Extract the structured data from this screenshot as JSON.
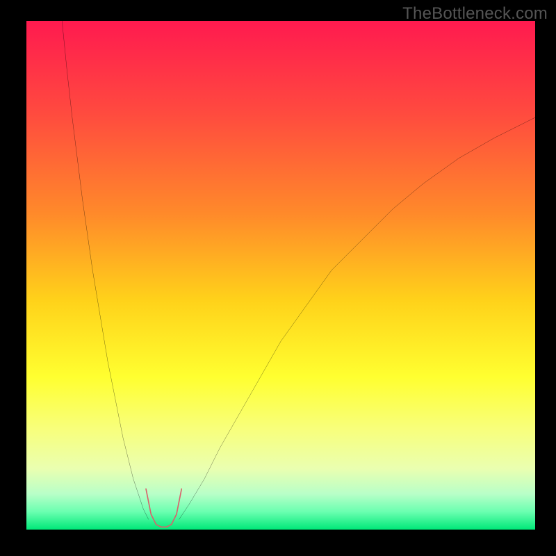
{
  "watermark": "TheBottleneck.com",
  "chart_data": {
    "type": "line",
    "title": "",
    "xlabel": "",
    "ylabel": "",
    "xlim": [
      0,
      100
    ],
    "ylim": [
      0,
      100
    ],
    "background_gradient": {
      "stops": [
        {
          "pos": 0.0,
          "color": "#ff1a4f"
        },
        {
          "pos": 0.18,
          "color": "#ff4a3f"
        },
        {
          "pos": 0.38,
          "color": "#ff8a2a"
        },
        {
          "pos": 0.55,
          "color": "#ffd21a"
        },
        {
          "pos": 0.7,
          "color": "#ffff30"
        },
        {
          "pos": 0.8,
          "color": "#f8ff7a"
        },
        {
          "pos": 0.88,
          "color": "#eaffb0"
        },
        {
          "pos": 0.93,
          "color": "#b8ffc8"
        },
        {
          "pos": 0.965,
          "color": "#6affb0"
        },
        {
          "pos": 1.0,
          "color": "#00e878"
        }
      ]
    },
    "series": [
      {
        "name": "left-branch",
        "stroke": "#000000",
        "stroke_width": 2,
        "x": [
          7,
          8,
          9,
          10,
          11,
          12,
          13,
          14,
          15,
          16,
          17,
          18,
          19,
          20,
          21,
          22,
          23,
          24
        ],
        "y": [
          100,
          90,
          81,
          73,
          65,
          58,
          51,
          45,
          39,
          33,
          28,
          23,
          18,
          14,
          10,
          7,
          4,
          2
        ]
      },
      {
        "name": "right-branch",
        "stroke": "#000000",
        "stroke_width": 2,
        "x": [
          30,
          32,
          35,
          38,
          42,
          46,
          50,
          55,
          60,
          66,
          72,
          78,
          85,
          92,
          100
        ],
        "y": [
          2,
          5,
          10,
          16,
          23,
          30,
          37,
          44,
          51,
          57,
          63,
          68,
          73,
          77,
          81
        ]
      }
    ],
    "highlight": {
      "name": "valley-highlight",
      "stroke": "#d9626b",
      "stroke_width": 12,
      "linecap": "round",
      "x": [
        23.5,
        24.5,
        25.5,
        26.5,
        27.5,
        28.5,
        29.5,
        30.5
      ],
      "y": [
        8.0,
        3.0,
        1.0,
        0.5,
        0.5,
        1.0,
        3.0,
        8.0
      ]
    }
  }
}
